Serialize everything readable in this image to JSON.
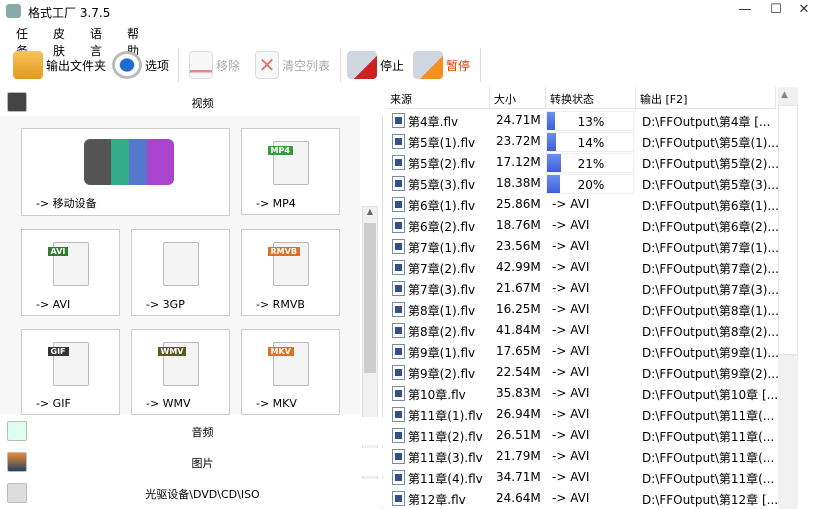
{
  "window": {
    "title": "格式工厂 3.7.5",
    "minimize": "—",
    "maximize": "☐",
    "close": "✕"
  },
  "menu": [
    "任务",
    "皮肤",
    "语言",
    "帮助"
  ],
  "toolbar": {
    "output_folder": "输出文件夹",
    "options": "选项",
    "remove": "移除",
    "clear_list": "清空列表",
    "stop": "停止",
    "pause": "暂停"
  },
  "colors": {
    "pause": "#d83b01",
    "progress": "#4a6ee0"
  },
  "categories": {
    "video": "视频",
    "audio": "音频",
    "picture": "图片",
    "rom": "光驱设备\\DVD\\CD\\ISO"
  },
  "tiles": [
    {
      "label": "-> 移动设备",
      "badge": ""
    },
    {
      "label": "-> MP4",
      "badge": "MP4",
      "color": "#3a9a3a"
    },
    {
      "label": "-> AVI",
      "badge": "AVI",
      "color": "#2c7d2c"
    },
    {
      "label": "-> 3GP",
      "badge": "",
      "color": "#3a9a3a"
    },
    {
      "label": "-> RMVB",
      "badge": "RMVB",
      "color": "#e07020"
    },
    {
      "label": "-> GIF",
      "badge": "GIF",
      "color": "#333333"
    },
    {
      "label": "-> WMV",
      "badge": "WMV",
      "color": "#5a5a20"
    },
    {
      "label": "-> MKV",
      "badge": "MKV",
      "color": "#e07020"
    }
  ],
  "list": {
    "headers": [
      "来源",
      "大小",
      "转换状态",
      "输出 [F2]"
    ],
    "rows": [
      {
        "src": "第4章.flv",
        "size": "24.71M",
        "progress": 13,
        "status": "13%",
        "out": "D:\\FFOutput\\第4章 [..."
      },
      {
        "src": "第5章(1).flv",
        "size": "23.72M",
        "progress": 14,
        "status": "14%",
        "out": "D:\\FFOutput\\第5章(1)..."
      },
      {
        "src": "第5章(2).flv",
        "size": "17.12M",
        "progress": 21,
        "status": "21%",
        "out": "D:\\FFOutput\\第5章(2)..."
      },
      {
        "src": "第5章(3).flv",
        "size": "18.38M",
        "progress": 20,
        "status": "20%",
        "out": "D:\\FFOutput\\第5章(3)..."
      },
      {
        "src": "第6章(1).flv",
        "size": "25.86M",
        "status": "-> AVI",
        "out": "D:\\FFOutput\\第6章(1)..."
      },
      {
        "src": "第6章(2).flv",
        "size": "18.76M",
        "status": "-> AVI",
        "out": "D:\\FFOutput\\第6章(2)..."
      },
      {
        "src": "第7章(1).flv",
        "size": "23.56M",
        "status": "-> AVI",
        "out": "D:\\FFOutput\\第7章(1)..."
      },
      {
        "src": "第7章(2).flv",
        "size": "42.99M",
        "status": "-> AVI",
        "out": "D:\\FFOutput\\第7章(2)..."
      },
      {
        "src": "第7章(3).flv",
        "size": "21.67M",
        "status": "-> AVI",
        "out": "D:\\FFOutput\\第7章(3)..."
      },
      {
        "src": "第8章(1).flv",
        "size": "16.25M",
        "status": "-> AVI",
        "out": "D:\\FFOutput\\第8章(1)..."
      },
      {
        "src": "第8章(2).flv",
        "size": "41.84M",
        "status": "-> AVI",
        "out": "D:\\FFOutput\\第8章(2)..."
      },
      {
        "src": "第9章(1).flv",
        "size": "17.65M",
        "status": "-> AVI",
        "out": "D:\\FFOutput\\第9章(1)..."
      },
      {
        "src": "第9章(2).flv",
        "size": "22.54M",
        "status": "-> AVI",
        "out": "D:\\FFOutput\\第9章(2)..."
      },
      {
        "src": "第10章.flv",
        "size": "35.83M",
        "status": "-> AVI",
        "out": "D:\\FFOutput\\第10章 [..."
      },
      {
        "src": "第11章(1).flv",
        "size": "26.94M",
        "status": "-> AVI",
        "out": "D:\\FFOutput\\第11章(..."
      },
      {
        "src": "第11章(2).flv",
        "size": "26.51M",
        "status": "-> AVI",
        "out": "D:\\FFOutput\\第11章(..."
      },
      {
        "src": "第11章(3).flv",
        "size": "21.79M",
        "status": "-> AVI",
        "out": "D:\\FFOutput\\第11章(..."
      },
      {
        "src": "第11章(4).flv",
        "size": "34.71M",
        "status": "-> AVI",
        "out": "D:\\FFOutput\\第11章(..."
      },
      {
        "src": "第12章.flv",
        "size": "24.64M",
        "status": "-> AVI",
        "out": "D:\\FFOutput\\第12章 [..."
      }
    ]
  }
}
